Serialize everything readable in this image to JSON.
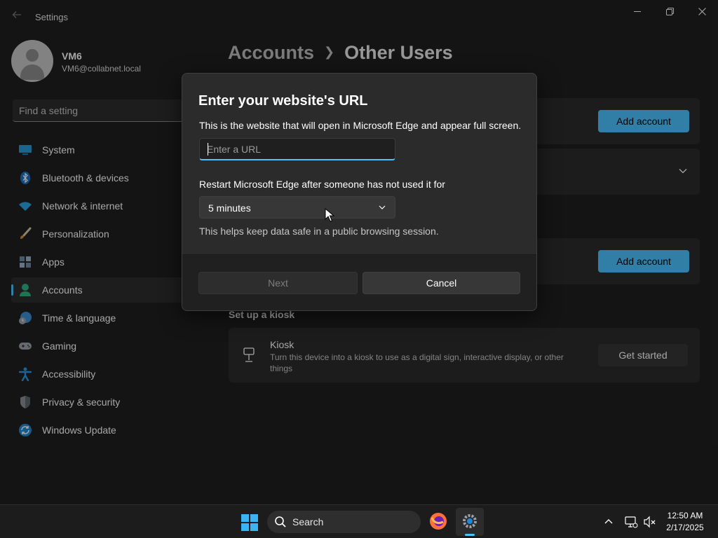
{
  "window": {
    "title": "Settings",
    "back_icon": "back-arrow-icon",
    "controls": [
      "minimize-icon",
      "maximize-icon",
      "close-icon"
    ]
  },
  "profile": {
    "name": "VM6",
    "email": "VM6@collabnet.local"
  },
  "search": {
    "placeholder": "Find a setting"
  },
  "sidebar": {
    "items": [
      {
        "label": "System",
        "icon": "system-icon"
      },
      {
        "label": "Bluetooth & devices",
        "icon": "bluetooth-icon"
      },
      {
        "label": "Network & internet",
        "icon": "network-icon"
      },
      {
        "label": "Personalization",
        "icon": "brush-icon"
      },
      {
        "label": "Apps",
        "icon": "apps-icon"
      },
      {
        "label": "Accounts",
        "icon": "accounts-icon",
        "active": true
      },
      {
        "label": "Time & language",
        "icon": "time-language-icon"
      },
      {
        "label": "Gaming",
        "icon": "gamepad-icon"
      },
      {
        "label": "Accessibility",
        "icon": "accessibility-icon"
      },
      {
        "label": "Privacy & security",
        "icon": "shield-icon"
      },
      {
        "label": "Windows Update",
        "icon": "windows-update-icon"
      }
    ]
  },
  "header": {
    "parent": "Accounts",
    "current": "Other Users"
  },
  "main": {
    "add_account_label_1": "Add account",
    "add_account_label_2": "Add account",
    "kiosk_section_title": "Set up a kiosk",
    "kiosk": {
      "title": "Kiosk",
      "description": "Turn this device into a kiosk to use as a digital sign, interactive display, or other things",
      "button": "Get started",
      "icon": "kiosk-icon"
    }
  },
  "dialog": {
    "title": "Enter your website's URL",
    "description": "This is the website that will open in Microsoft Edge and appear full screen.",
    "url_placeholder": "Enter a URL",
    "url_value": "",
    "restart_label": "Restart Microsoft Edge after someone has not used it for",
    "restart_selected": "5 minutes",
    "help_text": "This helps keep data safe in a public browsing session.",
    "next_label": "Next",
    "cancel_label": "Cancel"
  },
  "taskbar": {
    "search_label": "Search",
    "time": "12:50 AM",
    "date": "2/17/2025"
  },
  "colors": {
    "accent": "#4cc2ff",
    "background": "#202020",
    "card": "#2b2b2b"
  }
}
